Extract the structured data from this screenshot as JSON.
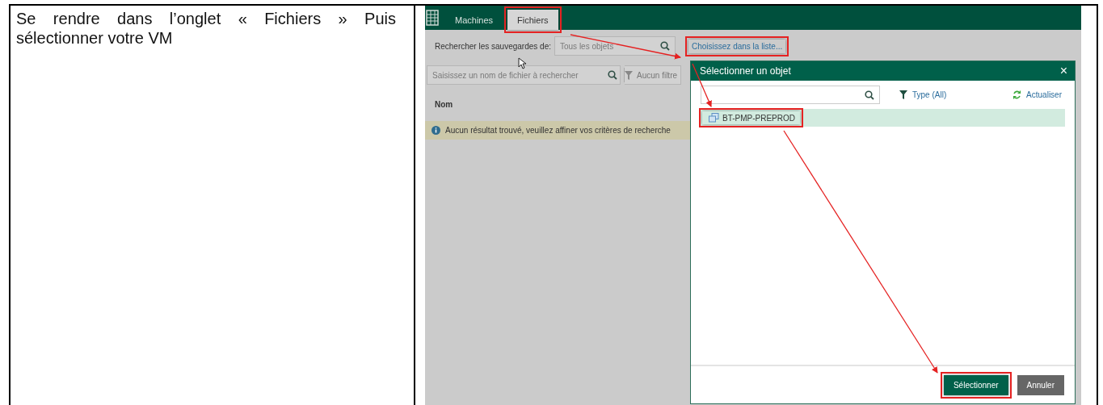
{
  "instruction": "Se rendre dans l’onglet « Fichiers » Puis sélectionner votre VM",
  "app": {
    "tabs": [
      {
        "label": "Machines",
        "selected": false,
        "highlighted": false
      },
      {
        "label": "Fichiers",
        "selected": true,
        "highlighted": true
      }
    ],
    "search_backups": {
      "label": "Rechercher les sauvegardes de:",
      "placeholder": "Tous les objets",
      "link": {
        "label": "Choisissez dans la liste...",
        "highlighted": true
      }
    },
    "file_search": {
      "placeholder": "Saisissez un nom de fichier à rechercher",
      "filter": "Aucun filtre"
    },
    "table": {
      "columns": [
        "Nom"
      ],
      "message": "Aucun résultat trouvé, veuillez affiner vos critères de recherche"
    },
    "dialog": {
      "title": "Sélectionner un objet",
      "close": "×",
      "type_filter": "Type (All)",
      "refresh": "Actualiser",
      "items": [
        {
          "label": "BT-PMP-PREPROD",
          "selected": true,
          "highlighted": true
        }
      ],
      "buttons": [
        {
          "label": "Sélectionner",
          "kind": "primary",
          "highlighted": true
        },
        {
          "label": "Annuler",
          "kind": "secondary",
          "highlighted": false
        }
      ]
    }
  }
}
